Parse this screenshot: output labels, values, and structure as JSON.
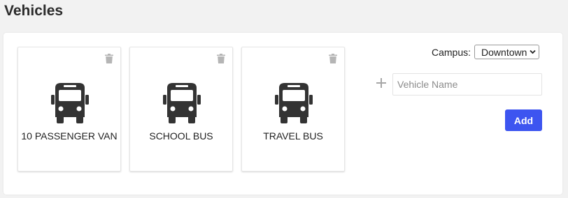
{
  "page": {
    "title": "Vehicles"
  },
  "vehicles": [
    {
      "name": "10 PASSENGER VAN",
      "icon": "bus-icon"
    },
    {
      "name": "SCHOOL BUS",
      "icon": "bus-icon"
    },
    {
      "name": "TRAVEL BUS",
      "icon": "bus-icon"
    }
  ],
  "campus": {
    "label": "Campus:",
    "selected": "Downtown"
  },
  "new_vehicle": {
    "placeholder": "Vehicle Name",
    "value": ""
  },
  "add_button": {
    "label": "Add"
  },
  "colors": {
    "accent": "#3d55f0",
    "icon": "#333333",
    "trash": "#b5b5b5"
  }
}
